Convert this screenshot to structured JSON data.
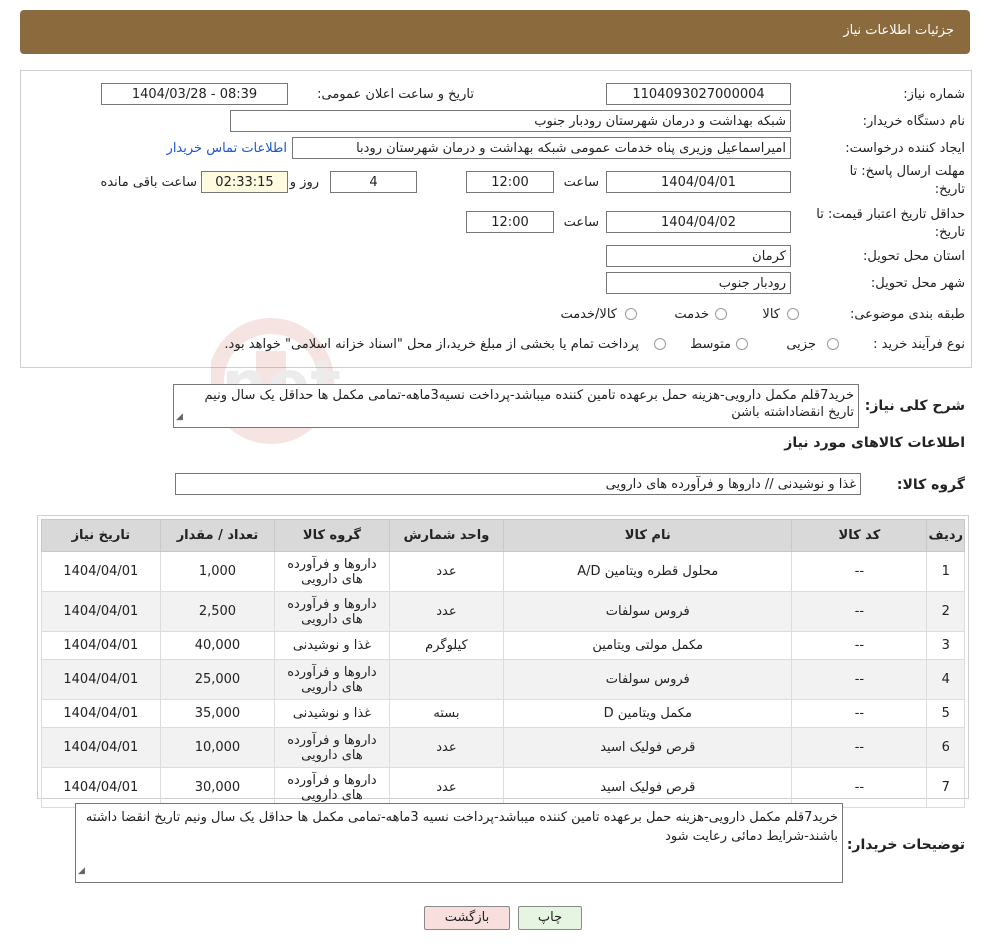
{
  "header": {
    "title": "جزئیات اطلاعات نیاز"
  },
  "fields": {
    "need_number_label": "شماره نیاز:",
    "need_number": "1104093027000004",
    "announce_label": "تاریخ و ساعت اعلان عمومی:",
    "announce_value": "1404/03/28 - 08:39",
    "buyer_org_label": "نام دستگاه خریدار:",
    "buyer_org": "شبکه بهداشت و درمان شهرستان رودبار جنوب",
    "creator_label": "ایجاد کننده درخواست:",
    "creator": "امیراسماعیل وزیری پناه خدمات عمومی شبکه بهداشت و درمان شهرستان رودبا",
    "contact_link": "اطلاعات تماس خریدار",
    "deadline_label_1": "مهلت ارسال پاسخ: تا",
    "deadline_label_2": "تاریخ:",
    "deadline_date": "1404/04/01",
    "time_label": "ساعت",
    "deadline_time": "12:00",
    "days": "4",
    "days_label": "روز و",
    "remaining": "02:33:15",
    "remaining_label": "ساعت باقی مانده",
    "validity_label_1": "حداقل تاریخ اعتبار قیمت: تا",
    "validity_label_2": "تاریخ:",
    "validity_date": "1404/04/02",
    "validity_time": "12:00",
    "province_label": "استان محل تحویل:",
    "province": "کرمان",
    "city_label": "شهر محل تحویل:",
    "city": "رودبار جنوب",
    "category_label": "طبقه بندی موضوعی:",
    "category_options": [
      "کالا",
      "خدمت",
      "کالا/خدمت"
    ],
    "process_label": "نوع فرآیند خرید :",
    "process_options": [
      "جزیی",
      "متوسط"
    ],
    "process_note": "پرداخت تمام یا بخشی از مبلغ خرید،از محل \"اسناد خزانه اسلامی\" خواهد بود."
  },
  "description": {
    "label": "شرح کلی نیاز:",
    "text": "خرید7قلم مکمل دارویی-هزینه حمل برعهده تامین کننده میباشد-پرداخت نسیه3ماهه-تمامی مکمل ها حداقل یک سال ونیم تاریخ انقضاداشته باشن"
  },
  "goods_section": {
    "title": "اطلاعات کالاهای مورد نیاز",
    "group_label": "گروه کالا:",
    "group_value": "غذا و نوشیدنی // داروها و فرآورده های دارویی"
  },
  "table": {
    "headers": [
      "ردیف",
      "کد کالا",
      "نام کالا",
      "واحد شمارش",
      "گروه کالا",
      "تعداد / مقدار",
      "تاریخ نیاز"
    ],
    "rows": [
      {
        "no": "1",
        "code": "--",
        "name": "محلول قطره ویتامین A/D",
        "unit": "عدد",
        "group": "داروها و فرآورده های دارویی",
        "qty": "1,000",
        "date": "1404/04/01"
      },
      {
        "no": "2",
        "code": "--",
        "name": "فروس سولفات",
        "unit": "عدد",
        "group": "داروها و فرآورده های دارویی",
        "qty": "2,500",
        "date": "1404/04/01"
      },
      {
        "no": "3",
        "code": "--",
        "name": "مکمل مولتی ویتامین",
        "unit": "کیلوگرم",
        "group": "غذا و نوشیدنی",
        "qty": "40,000",
        "date": "1404/04/01"
      },
      {
        "no": "4",
        "code": "--",
        "name": "فروس سولفات",
        "unit": "",
        "group": "داروها و فرآورده های دارویی",
        "qty": "25,000",
        "date": "1404/04/01"
      },
      {
        "no": "5",
        "code": "--",
        "name": "مکمل ویتامین D",
        "unit": "بسته",
        "group": "غذا و نوشیدنی",
        "qty": "35,000",
        "date": "1404/04/01"
      },
      {
        "no": "6",
        "code": "--",
        "name": "قرص فولیک اسید",
        "unit": "عدد",
        "group": "داروها و فرآورده های دارویی",
        "qty": "10,000",
        "date": "1404/04/01"
      },
      {
        "no": "7",
        "code": "--",
        "name": "قرص فولیک اسید",
        "unit": "عدد",
        "group": "داروها و فرآورده های دارویی",
        "qty": "30,000",
        "date": "1404/04/01"
      }
    ]
  },
  "notes": {
    "label": "توضیحات خریدار:",
    "text": "خرید7قلم مکمل دارویی-هزینه حمل برعهده تامین کننده میباشد-پرداخت نسیه 3ماهه-تمامی مکمل ها حداقل یک سال ونیم تاریخ انقضا داشته باشند-شرایط دمائی رعایت شود"
  },
  "buttons": {
    "print": "چاپ",
    "back": "بازگشت"
  },
  "watermark": "AriaTender.net",
  "colors": {
    "header": "#8b6a3e",
    "link": "#1a56d6",
    "print_btn": "#e6f5e1",
    "back_btn": "#f9dede"
  }
}
